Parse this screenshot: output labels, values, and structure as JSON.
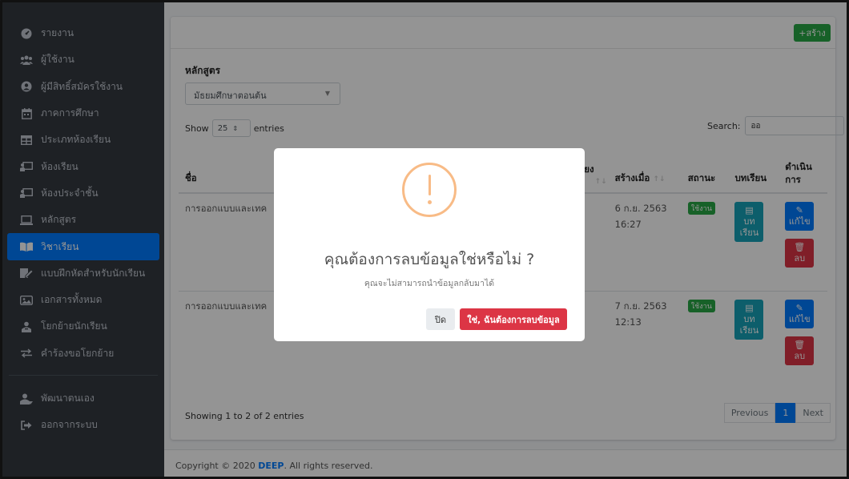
{
  "sidebar": {
    "items": [
      {
        "label": "รายงาน",
        "icon": "dashboard-icon"
      },
      {
        "label": "ผู้ใช้งาน",
        "icon": "users-icon"
      },
      {
        "label": "ผู้มีสิทธิ์สมัครใช้งาน",
        "icon": "user-circle-icon"
      },
      {
        "label": "ภาคการศึกษา",
        "icon": "calendar-icon"
      },
      {
        "label": "ประเภทห้องเรียน",
        "icon": "table-icon"
      },
      {
        "label": "ห้องเรียน",
        "icon": "chalkboard-icon"
      },
      {
        "label": "ห้องประจำชั้น",
        "icon": "chalkboard-teacher-icon"
      },
      {
        "label": "หลักสูตร",
        "icon": "laptop-icon"
      },
      {
        "label": "วิชาเรียน",
        "icon": "book-open-icon"
      },
      {
        "label": "แบบฝึกหัดสำหรับนักเรียน",
        "icon": "pen-icon"
      },
      {
        "label": "เอกสารทั้งหมด",
        "icon": "photo-icon"
      },
      {
        "label": "โยกย้ายนักเรียน",
        "icon": "user-move-icon"
      },
      {
        "label": "คำร้องขอโยกย้าย",
        "icon": "exchange-icon"
      }
    ],
    "bottom_items": [
      {
        "label": "พัฒนาตนเอง",
        "icon": "user-develop-icon"
      },
      {
        "label": "ออกจากระบบ",
        "icon": "sign-out-icon"
      }
    ]
  },
  "header": {
    "create_label": "+สร้าง"
  },
  "filter": {
    "course_label": "หลักสูตร",
    "course_value": "มัธยมศึกษาตอนต้น",
    "show_label": "Show",
    "length_value": "25",
    "entries_label": "entries",
    "search_label": "Search:",
    "search_value": "ออ"
  },
  "table": {
    "columns": {
      "name": "ชื่อ",
      "hidden_partial": "ยง",
      "created": "สร้างเมื่อ",
      "status": "สถานะ",
      "lessons": "บทเรียน",
      "actions": "ดำเนินการ"
    },
    "rows": [
      {
        "name": "การออกแบบและเทค",
        "created_date": "6 ก.ย. 2563",
        "created_time": "16:27",
        "status": "ใช้งาน"
      },
      {
        "name": "การออกแบบและเทค",
        "created_date": "7 ก.ย. 2563",
        "created_time": "12:13",
        "status": "ใช้งาน"
      }
    ],
    "lesson_btn_line1": "บท",
    "lesson_btn_line2": "เรียน",
    "edit_btn": "แก้ไข",
    "delete_btn": "ลบ"
  },
  "pagination": {
    "info": "Showing 1 to 2 of 2 entries",
    "previous": "Previous",
    "current": "1",
    "next": "Next"
  },
  "footer": {
    "prefix": "Copyright © 2020 ",
    "brand": "DEEP",
    "suffix": ". All rights reserved."
  },
  "modal": {
    "title": "คุณต้องการลบข้อมูลใช่หรือไม่ ?",
    "text": "คุณจะไม่สามารถนำข้อมูลกลับมาได้",
    "cancel": "ปิด",
    "confirm": "ใช่, ฉันต้องการลบข้อมูล"
  },
  "colors": {
    "primary": "#007bff",
    "success": "#28a745",
    "danger": "#dc3545",
    "info": "#17a2b8",
    "warning_icon": "#f8bb86",
    "sidebar": "#343a40"
  }
}
